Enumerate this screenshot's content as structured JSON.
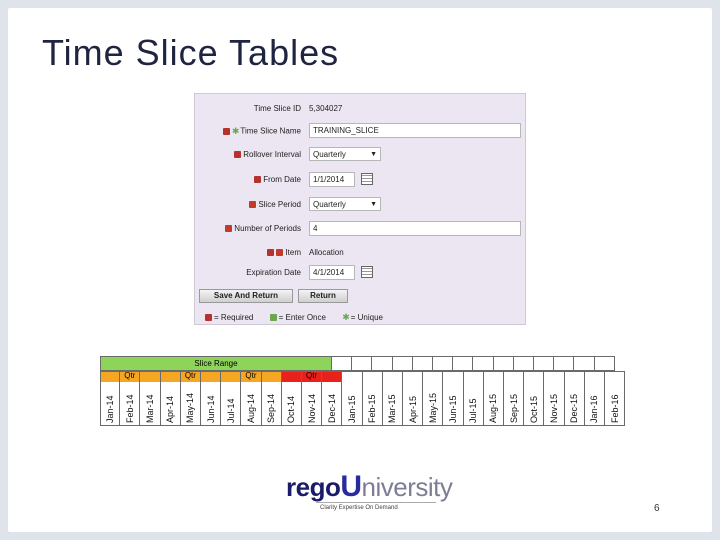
{
  "slide": {
    "title": "Time Slice Tables",
    "page_number": "6"
  },
  "form": {
    "rows": [
      {
        "label": "Time Slice ID",
        "value": "5,304027",
        "kind": "text",
        "marker": ""
      },
      {
        "label": "Time Slice Name",
        "value": "TRAINING_SLICE",
        "kind": "input",
        "marker": "req-unique"
      },
      {
        "label": "Rollover Interval",
        "value": "Quarterly",
        "kind": "select",
        "marker": "req"
      },
      {
        "label": "From Date",
        "value": "1/1/2014",
        "kind": "date",
        "marker": "req"
      },
      {
        "label": "Slice Period",
        "value": "Quarterly",
        "kind": "select",
        "marker": "err"
      },
      {
        "label": "Number of Periods",
        "value": "4",
        "kind": "input-wide",
        "marker": "err"
      },
      {
        "label": "Item",
        "value": "Allocation",
        "kind": "text",
        "marker": "req-err"
      },
      {
        "label": "Expiration Date",
        "value": "4/1/2014",
        "kind": "date",
        "marker": ""
      }
    ],
    "buttons": {
      "save_return": "Save And Return",
      "return": "Return"
    },
    "legend": {
      "required": "= Required",
      "enter_once": "= Enter Once",
      "unique": "= Unique"
    }
  },
  "timeline": {
    "header": "Slice Range",
    "quarters": [
      {
        "label": "Qtr",
        "color": "#f5a623"
      },
      {
        "label": "Qtr",
        "color": "#f5a623"
      },
      {
        "label": "Qtr",
        "color": "#f5a623"
      },
      {
        "label": "Qtr",
        "color": "#e8221b"
      }
    ],
    "months": [
      "Jan-14",
      "Feb-14",
      "Mar-14",
      "Apr-14",
      "May-14",
      "Jun-14",
      "Jul-14",
      "Aug-14",
      "Sep-14",
      "Oct-14",
      "Nov-14",
      "Dec-14",
      "Jan-15",
      "Feb-15",
      "Mar-15",
      "Apr-15",
      "May-15",
      "Jun-15",
      "Jul-15",
      "Aug-15",
      "Sep-15",
      "Oct-15",
      "Nov-15",
      "Dec-15",
      "Jan-16",
      "Feb-16"
    ]
  },
  "logo": {
    "rego": "rego",
    "u": "U",
    "niversity": "niversity",
    "tagline": "Clarity Expertise On Demand"
  }
}
